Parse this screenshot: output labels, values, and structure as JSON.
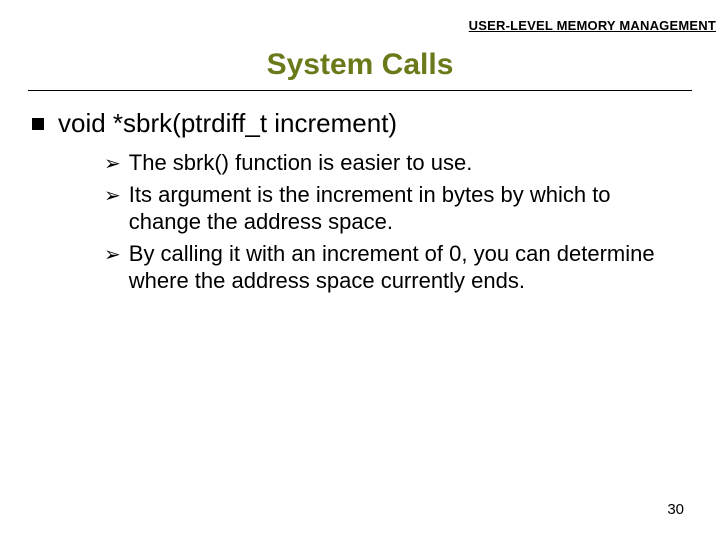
{
  "header": {
    "section_label": "USER-LEVEL MEMORY MANAGEMENT"
  },
  "title": "System Calls",
  "content": {
    "item": {
      "text": "void *sbrk(ptrdiff_t increment)"
    },
    "subitems": [
      {
        "text": "The sbrk() function is easier to use."
      },
      {
        "text": "Its argument is the increment in bytes by which to change the address space."
      },
      {
        "text": " By calling it with an increment of 0, you can determine where the address space currently ends."
      }
    ]
  },
  "page_number": "30"
}
